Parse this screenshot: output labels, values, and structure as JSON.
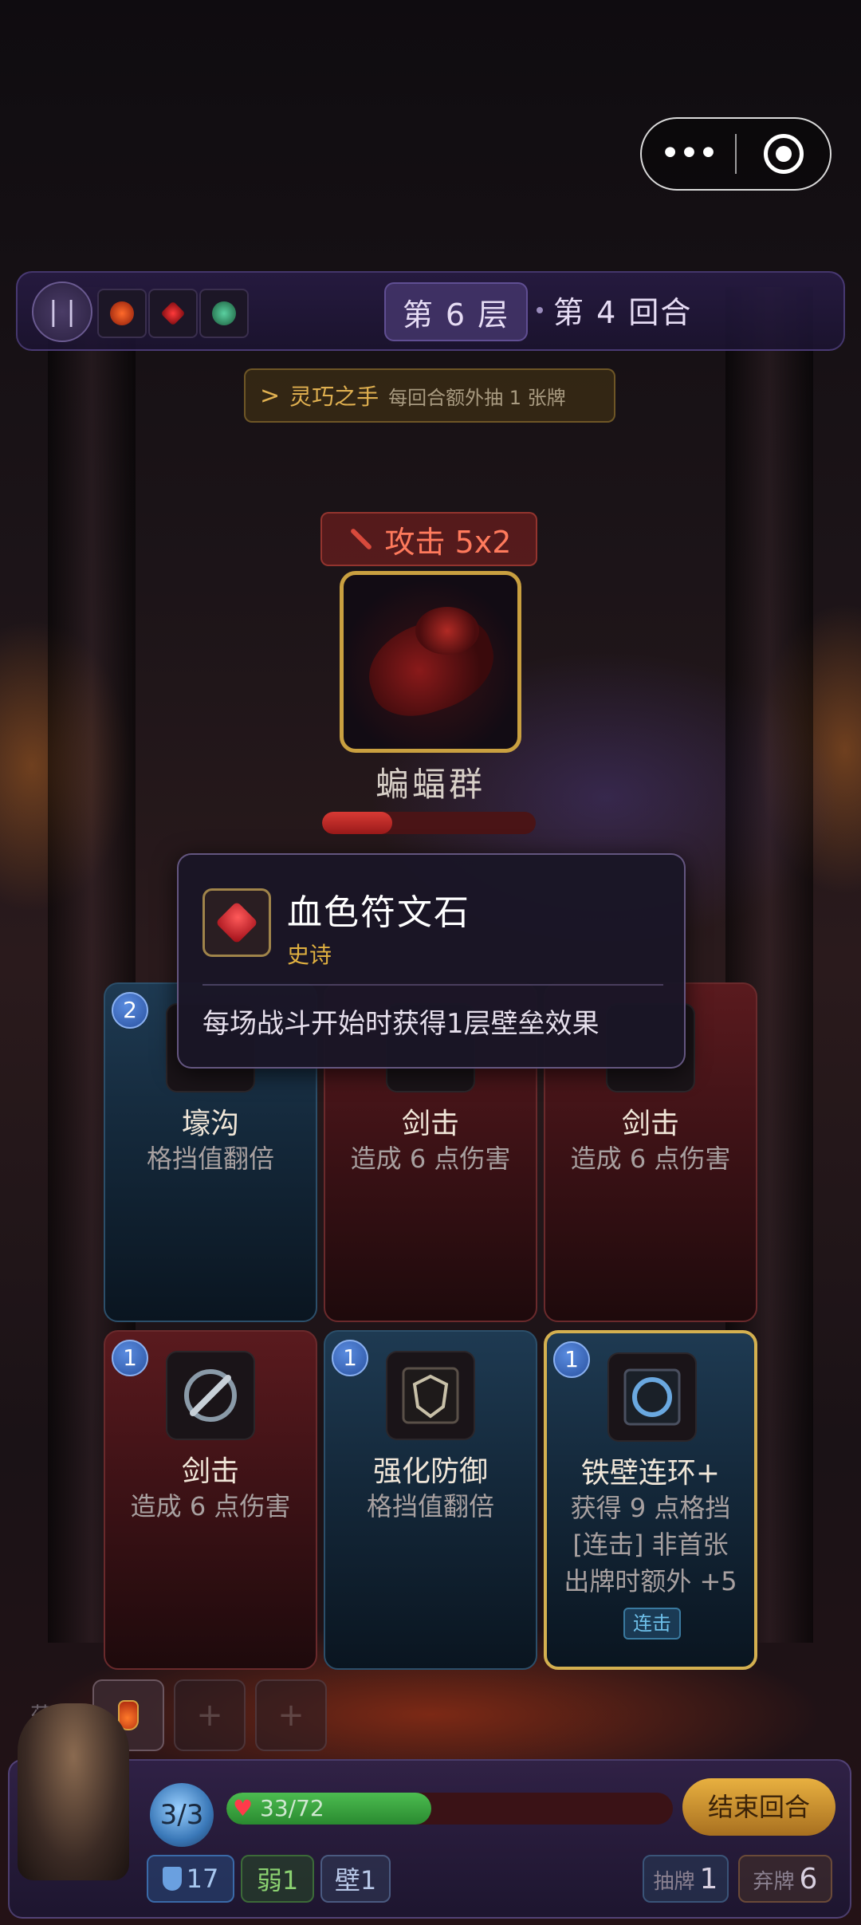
{
  "topbar": {
    "floor_label": "第 6 层",
    "turn_label": "第 4 回合",
    "relics": [
      {
        "icon": "fire-relic-icon",
        "color": "#d8401c"
      },
      {
        "icon": "blood-gem-relic-icon",
        "color": "#c01020"
      },
      {
        "icon": "jade-relic-icon",
        "color": "#2aa06a"
      }
    ]
  },
  "buff": {
    "chevron": ">",
    "name": "灵巧之手",
    "desc": "每回合额外抽 1 张牌"
  },
  "enemy": {
    "intent_label": "攻击 5x2",
    "name": "蝙蝠群",
    "hp_fraction": 0.33
  },
  "tooltip": {
    "name": "血色符文石",
    "rarity": "史诗",
    "desc": "每场战斗开始时获得1层壁垒效果"
  },
  "cards": [
    {
      "cost": "2",
      "title": "壕沟",
      "desc": "格挡值翻倍",
      "style": "blue"
    },
    {
      "cost": "",
      "title": "剑击",
      "desc": "造成 6 点伤害",
      "style": "red"
    },
    {
      "cost": "",
      "title": "剑击",
      "desc": "造成 6 点伤害",
      "style": "red"
    },
    {
      "cost": "1",
      "title": "剑击",
      "desc": "造成 6 点伤害",
      "style": "red"
    },
    {
      "cost": "1",
      "title": "强化防御",
      "desc": "格挡值翻倍",
      "style": "blue"
    },
    {
      "cost": "1",
      "title": "铁壁连环+",
      "desc_lines": [
        "获得 9 点格挡",
        "[连击] 非首张",
        "出牌时额外 +5"
      ],
      "tag": "连击",
      "style": "blue",
      "selected": true
    }
  ],
  "potions": {
    "label": "药水",
    "slots": [
      {
        "filled": true,
        "plus": ""
      },
      {
        "filled": false,
        "plus": "+"
      },
      {
        "filled": false,
        "plus": "+"
      }
    ]
  },
  "player": {
    "energy": "3/3",
    "hp": "33/72",
    "hp_current": 33,
    "hp_max": 72,
    "block": "17",
    "weak": "弱1",
    "wall": "壁1"
  },
  "actions": {
    "end_turn": "结束回合"
  },
  "piles": {
    "draw_label": "抽牌",
    "draw_count": "1",
    "discard_label": "弃牌",
    "discard_count": "6"
  },
  "capsule": {
    "more": "•••"
  }
}
